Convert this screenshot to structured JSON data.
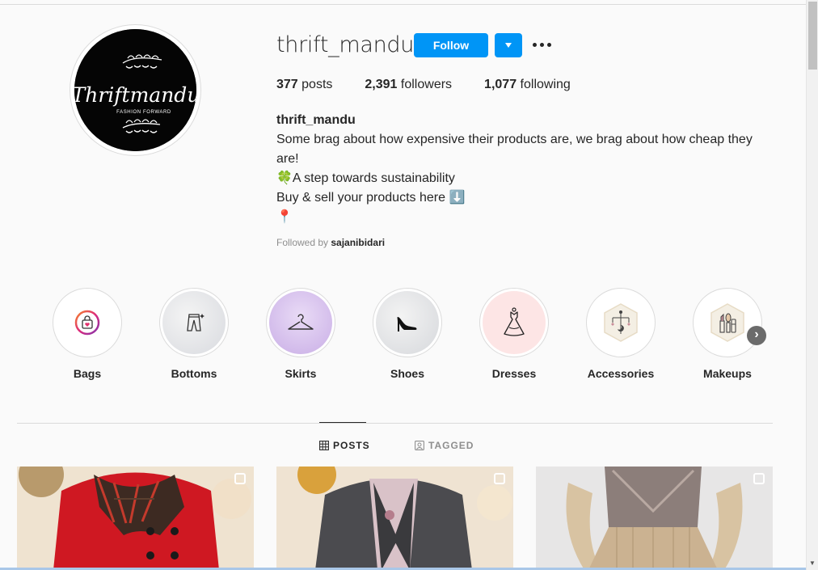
{
  "profile": {
    "username": "thrift_mandu",
    "follow_label": "Follow",
    "logo_text": "Thriftmandu",
    "logo_tagline": "FASHION FORWARD"
  },
  "stats": {
    "posts_count": "377",
    "posts_label": "posts",
    "followers_count": "2,391",
    "followers_label": "followers",
    "following_count": "1,077",
    "following_label": "following"
  },
  "bio": {
    "name": "thrift_mandu",
    "line1": "Some brag about how expensive their products are, we brag about how cheap they are!",
    "line2": "🍀A step towards sustainability",
    "line3": "Buy & sell your products here ⬇️",
    "line4": "📍",
    "followed_by_prefix": "Followed by",
    "followed_by_user": "sajanibidari"
  },
  "highlights": [
    {
      "label": "Bags",
      "icon": "bag-icon"
    },
    {
      "label": "Bottoms",
      "icon": "bottoms-icon"
    },
    {
      "label": "Skirts",
      "icon": "hanger-icon"
    },
    {
      "label": "Shoes",
      "icon": "high-heel-icon"
    },
    {
      "label": "Dresses",
      "icon": "dress-icon"
    },
    {
      "label": "Accessories",
      "icon": "accessories-icon"
    },
    {
      "label": "Makeups",
      "icon": "makeup-icon"
    }
  ],
  "tabs": {
    "posts": "POSTS",
    "tagged": "TAGGED"
  },
  "colors": {
    "follow_blue": "#0095f6",
    "text": "#262626",
    "muted": "#8e8e8e"
  }
}
